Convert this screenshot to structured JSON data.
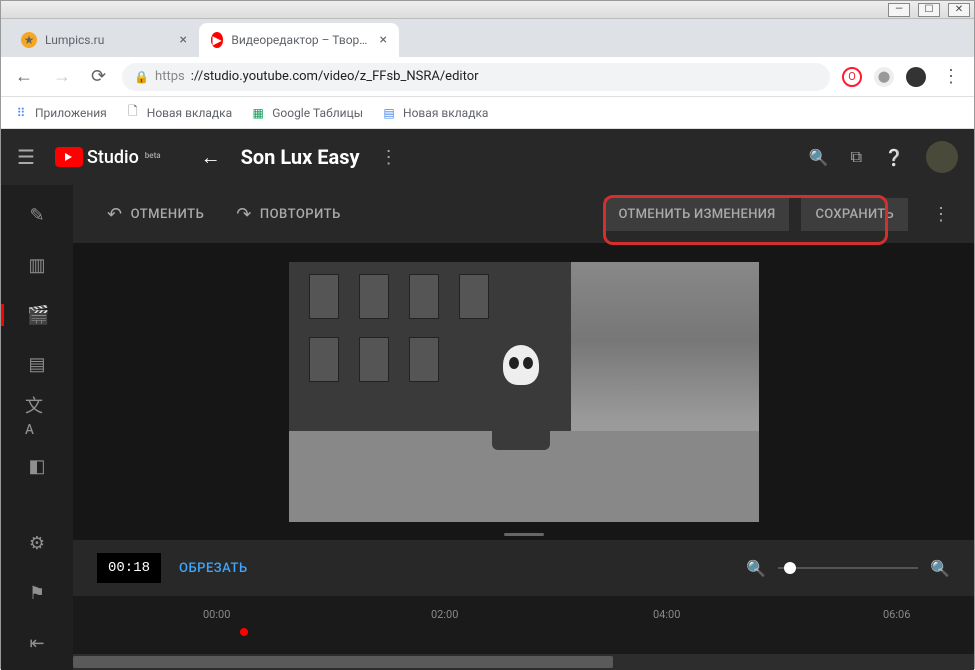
{
  "window": {
    "min": "—",
    "max": "☐",
    "close": "✕"
  },
  "tabs": [
    {
      "title": "Lumpics.ru",
      "favcolor": "#f5a623"
    },
    {
      "title": "Видеоредактор – Творческая ст",
      "favcolor": "#ff0000"
    }
  ],
  "address": {
    "url_https": "https",
    "url_rest": "://studio.youtube.com/video/z_FFsb_NSRA/editor"
  },
  "bookmarks": {
    "apps": "Приложения",
    "b1": "Новая вкладка",
    "b2": "Google Таблицы",
    "b3": "Новая вкладка"
  },
  "topbar": {
    "logo": "Studio",
    "beta": "beta",
    "video_title": "Son Lux Easy"
  },
  "toolbar": {
    "undo": "ОТМЕНИТЬ",
    "redo": "ПОВТОРИТЬ",
    "discard": "ОТМЕНИТЬ ИЗМЕНЕНИЯ",
    "save": "СОХРАНИТЬ"
  },
  "controls": {
    "time": "00:18",
    "trim": "ОБРЕЗАТЬ"
  },
  "timeline": {
    "t0": "00:00",
    "t1": "02:00",
    "t2": "04:00",
    "t3": "06:06"
  }
}
